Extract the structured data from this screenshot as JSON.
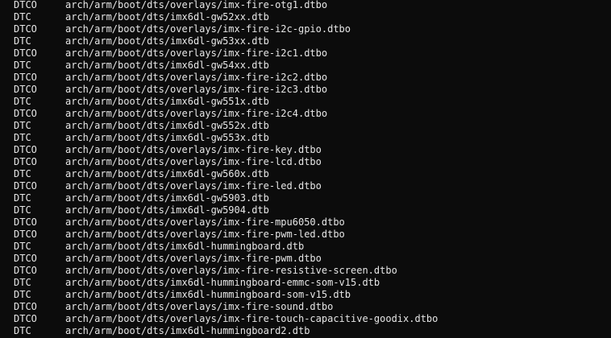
{
  "terminal": {
    "lines": [
      {
        "tag": "DTCO",
        "path": "arch/arm/boot/dts/overlays/imx-fire-otg1.dtbo"
      },
      {
        "tag": "DTC",
        "path": "arch/arm/boot/dts/imx6dl-gw52xx.dtb"
      },
      {
        "tag": "DTCO",
        "path": "arch/arm/boot/dts/overlays/imx-fire-i2c-gpio.dtbo"
      },
      {
        "tag": "DTC",
        "path": "arch/arm/boot/dts/imx6dl-gw53xx.dtb"
      },
      {
        "tag": "DTCO",
        "path": "arch/arm/boot/dts/overlays/imx-fire-i2c1.dtbo"
      },
      {
        "tag": "DTC",
        "path": "arch/arm/boot/dts/imx6dl-gw54xx.dtb"
      },
      {
        "tag": "DTCO",
        "path": "arch/arm/boot/dts/overlays/imx-fire-i2c2.dtbo"
      },
      {
        "tag": "DTCO",
        "path": "arch/arm/boot/dts/overlays/imx-fire-i2c3.dtbo"
      },
      {
        "tag": "DTC",
        "path": "arch/arm/boot/dts/imx6dl-gw551x.dtb"
      },
      {
        "tag": "DTCO",
        "path": "arch/arm/boot/dts/overlays/imx-fire-i2c4.dtbo"
      },
      {
        "tag": "DTC",
        "path": "arch/arm/boot/dts/imx6dl-gw552x.dtb"
      },
      {
        "tag": "DTC",
        "path": "arch/arm/boot/dts/imx6dl-gw553x.dtb"
      },
      {
        "tag": "DTCO",
        "path": "arch/arm/boot/dts/overlays/imx-fire-key.dtbo"
      },
      {
        "tag": "DTCO",
        "path": "arch/arm/boot/dts/overlays/imx-fire-lcd.dtbo"
      },
      {
        "tag": "DTC",
        "path": "arch/arm/boot/dts/imx6dl-gw560x.dtb"
      },
      {
        "tag": "DTCO",
        "path": "arch/arm/boot/dts/overlays/imx-fire-led.dtbo"
      },
      {
        "tag": "DTC",
        "path": "arch/arm/boot/dts/imx6dl-gw5903.dtb"
      },
      {
        "tag": "DTC",
        "path": "arch/arm/boot/dts/imx6dl-gw5904.dtb"
      },
      {
        "tag": "DTCO",
        "path": "arch/arm/boot/dts/overlays/imx-fire-mpu6050.dtbo"
      },
      {
        "tag": "DTCO",
        "path": "arch/arm/boot/dts/overlays/imx-fire-pwm-led.dtbo"
      },
      {
        "tag": "DTC",
        "path": "arch/arm/boot/dts/imx6dl-hummingboard.dtb"
      },
      {
        "tag": "DTCO",
        "path": "arch/arm/boot/dts/overlays/imx-fire-pwm.dtbo"
      },
      {
        "tag": "DTCO",
        "path": "arch/arm/boot/dts/overlays/imx-fire-resistive-screen.dtbo"
      },
      {
        "tag": "DTC",
        "path": "arch/arm/boot/dts/imx6dl-hummingboard-emmc-som-v15.dtb"
      },
      {
        "tag": "DTC",
        "path": "arch/arm/boot/dts/imx6dl-hummingboard-som-v15.dtb"
      },
      {
        "tag": "DTCO",
        "path": "arch/arm/boot/dts/overlays/imx-fire-sound.dtbo"
      },
      {
        "tag": "DTCO",
        "path": "arch/arm/boot/dts/overlays/imx-fire-touch-capacitive-goodix.dtbo"
      },
      {
        "tag": "DTC",
        "path": "arch/arm/boot/dts/imx6dl-hummingboard2.dtb"
      }
    ]
  },
  "colors": {
    "background": "#0c0c0c",
    "foreground": "#e6e6e6"
  }
}
